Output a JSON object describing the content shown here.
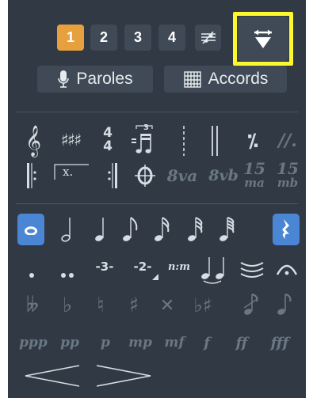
{
  "voices": [
    "1",
    "2",
    "3",
    "4"
  ],
  "buttons": {
    "lyrics": "Paroles",
    "chords": "Accords"
  },
  "row1": {
    "clef": "𝄞",
    "keysig": "♯♯♯",
    "time_top": "4",
    "time_bottom": "4",
    "tuplet": "3",
    "slash": "𝄎",
    "dslash": "//."
  },
  "row2": {
    "repeat_end_mark": "x.",
    "coda": "𝄌",
    "ottava_up": "8va",
    "ottava_down": "8vb",
    "quindicesima_up_a": "15",
    "quindicesima_up_b": "ma",
    "quindicesima_down_a": "15",
    "quindicesima_down_b": "mb"
  },
  "durations": [
    "𝅝",
    "𝅗𝅥",
    "♩",
    "♪",
    "𝅘𝅥𝅯",
    "𝅘𝅥𝅰",
    "𝅘𝅥𝅱",
    "𝄽"
  ],
  "rhythm": {
    "triplet": "-3-",
    "duplet": "-2-",
    "ratio": "n:m"
  },
  "accidentals": [
    "𝄫",
    "♭",
    "♮",
    "♯",
    "𝄪",
    "♭♯"
  ],
  "dynamics": [
    "ppp",
    "pp",
    "p",
    "mp",
    "mf",
    "f",
    "ff",
    "fff"
  ],
  "colors": {
    "panel": "#313a44",
    "button": "#3f4a56",
    "active_voice": "#e6a13e",
    "selected": "#4a86d4",
    "highlight": "#fcf72f"
  }
}
